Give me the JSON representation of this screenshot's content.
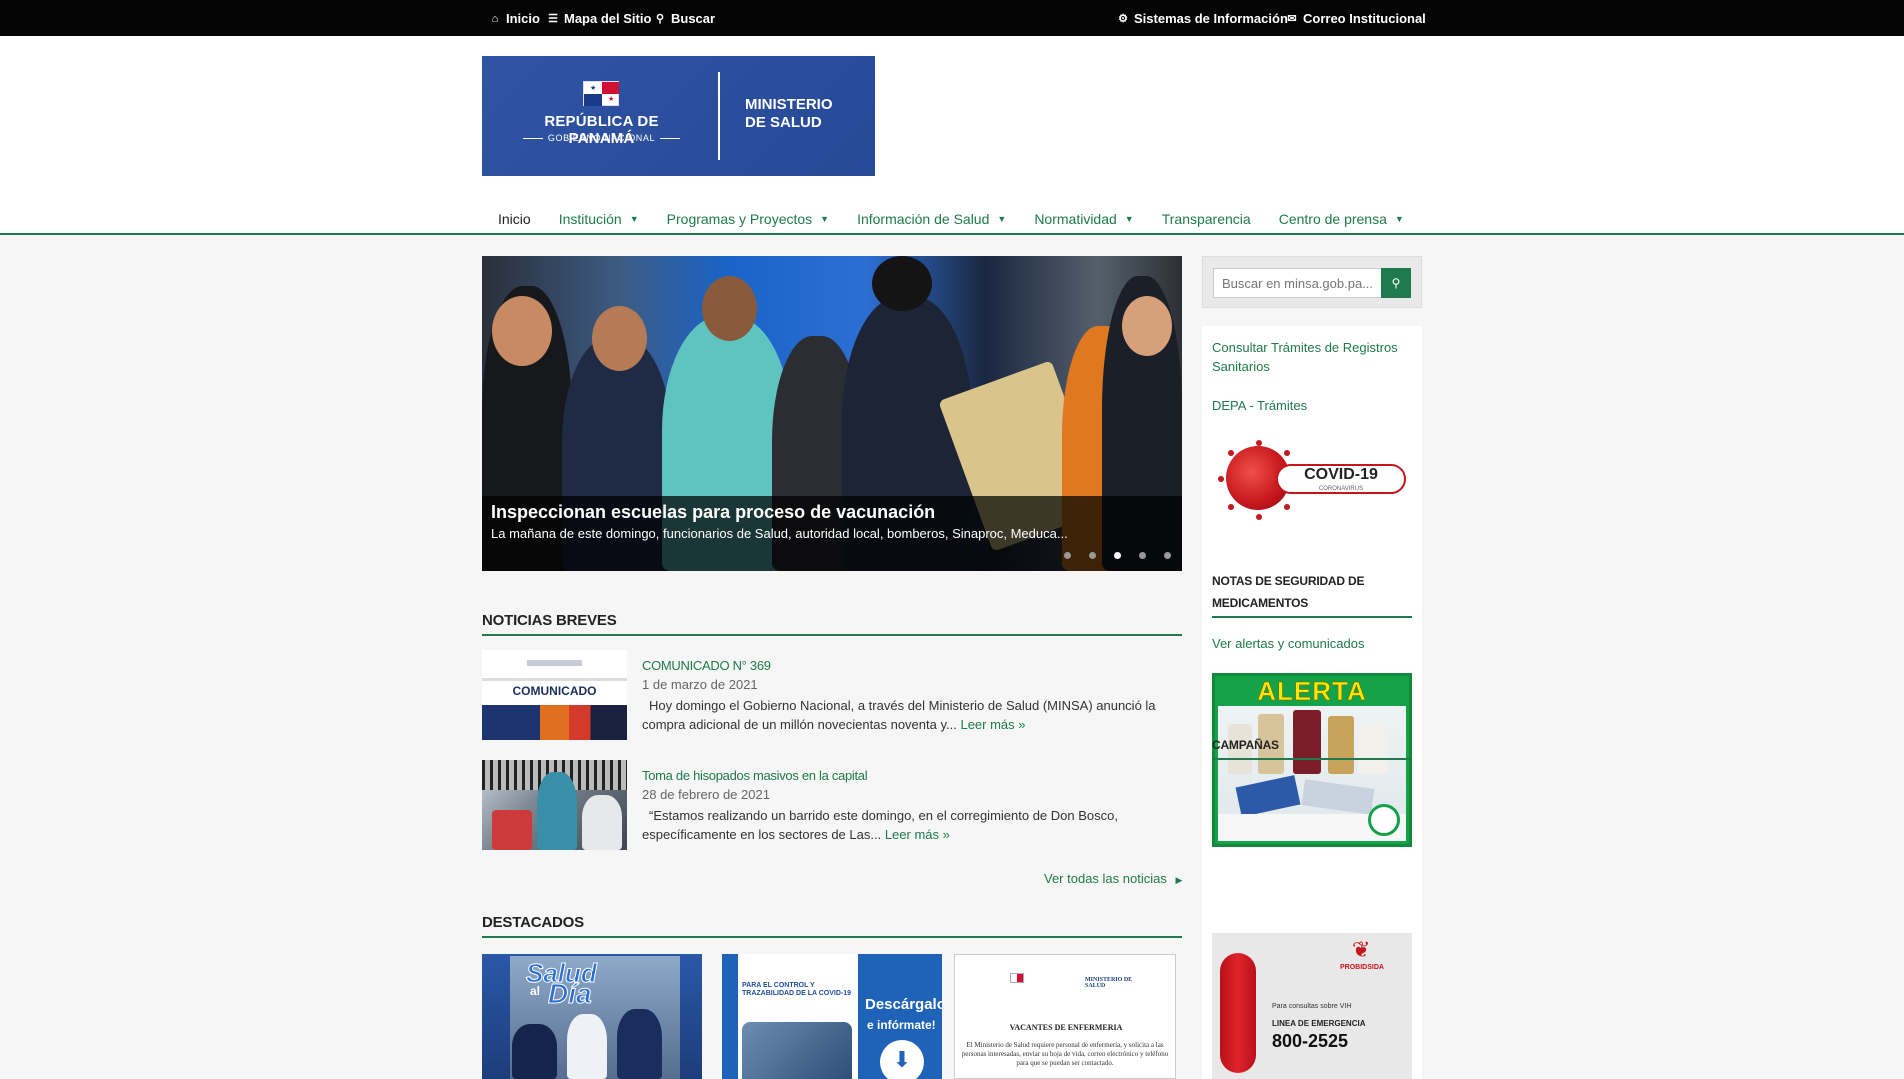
{
  "topbar": {
    "inicio": "Inicio",
    "mapa": "Mapa del Sitio",
    "buscar": "Buscar",
    "sistemas": "Sistemas de Información",
    "correo": "Correo Institucional"
  },
  "logo": {
    "republica": "REPÚBLICA DE PANAMÁ",
    "gobierno": "GOBIERNO NACIONAL",
    "ministerio_line1": "MINISTERIO",
    "ministerio_line2": "DE SALUD"
  },
  "nav": [
    {
      "label": "Inicio",
      "dropdown": false
    },
    {
      "label": "Institución",
      "dropdown": true
    },
    {
      "label": "Programas y Proyectos",
      "dropdown": true
    },
    {
      "label": "Información de Salud",
      "dropdown": true
    },
    {
      "label": "Normatividad",
      "dropdown": true
    },
    {
      "label": "Transparencia",
      "dropdown": false
    },
    {
      "label": "Centro de prensa",
      "dropdown": true
    }
  ],
  "slider": {
    "title": "Inspeccionan escuelas para proceso de vacunación",
    "text": "La mañana de este domingo, funcionarios de Salud, autoridad local, bomberos, Sinaproc, Meduca...",
    "slide_count": 5,
    "active_slide": 3
  },
  "noticias": {
    "heading": "NOTICIAS BREVES",
    "items": [
      {
        "title": "COMUNICADO N° 369",
        "date": "1 de marzo de 2021",
        "body": "Hoy domingo el Gobierno Nacional, a través del Ministerio de Salud (MINSA) anunció la compra adicional de un millón novecientas noventa y...",
        "more": "Leer más »",
        "thumb_label": "COMUNICADO"
      },
      {
        "title": "Toma de hisopados masivos en la capital",
        "date": "28 de febrero de 2021",
        "body": "“Estamos realizando un barrido este domingo, en el corregimiento de Don Bosco, específicamente en los sectores de Las...",
        "more": "Leer más »"
      }
    ],
    "all_news": "Ver todas las noticias"
  },
  "destacados": {
    "heading": "DESTACADOS",
    "items": [
      {
        "title_a": "Salud",
        "title_b": "al",
        "title_c": "Día"
      },
      {
        "head": "PARA EL CONTROL Y TRAZABILIDAD DE LA COVID-19",
        "cta1": "Descárgalo",
        "cta2": "e infórmate!"
      },
      {
        "ministry": "MINISTERIO DE SALUD",
        "heading": "VACANTES DE ENFERMERIA",
        "body": "El Ministerio de Salud requiere personal de enfermería, y solicita a las personas interesadas, enviar su hoja de vida, correo electrónico y teléfono para que se puedan ser contactado."
      }
    ]
  },
  "search": {
    "placeholder": "Buscar en minsa.gob.pa..."
  },
  "sidebar": {
    "link1": "Consultar Trámites de Registros Sanitarios",
    "link2": "DEPA - Trámites",
    "covid_label": "COVID-19",
    "covid_sub": "CORONAVIRUS",
    "notas_title": "NOTAS DE SEGURIDAD DE MEDICAMENTOS",
    "notas_link": "Ver alertas y comunicados",
    "alerta": "ALERTA",
    "campanas_title": "CAMPAÑAS",
    "campana": {
      "org": "PROBIDSIDA",
      "line1": "Para consultas sobre VIH",
      "line2": "LINEA DE EMERGENCIA",
      "phone": "800-2525"
    }
  },
  "colors": {
    "brand_green": "#1f7a4d",
    "topbar": "#050505",
    "logo_blue": "#2f54a3"
  }
}
